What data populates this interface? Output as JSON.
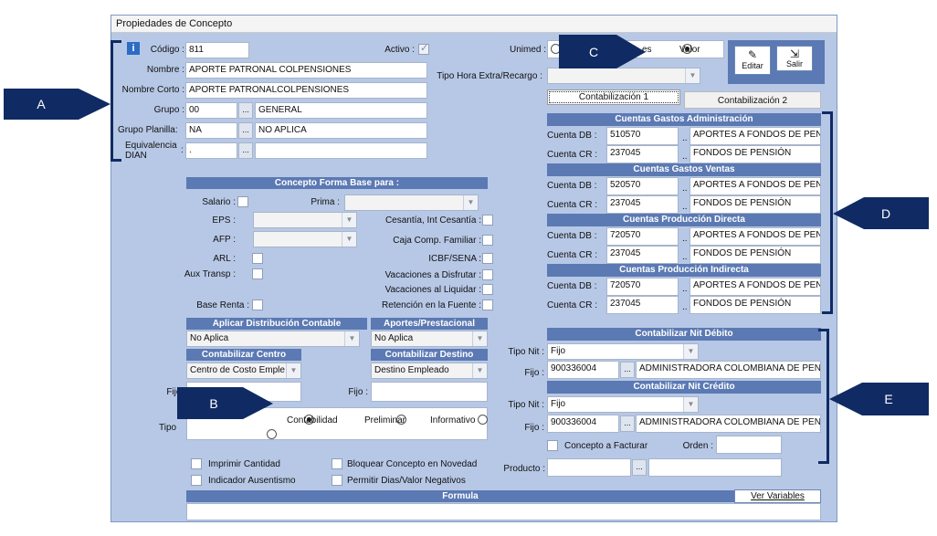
{
  "window": {
    "title": "Propiedades de Concepto"
  },
  "header": {
    "codigo_label": "Código :",
    "codigo_value": "811",
    "activo_label": "Activo :",
    "nombre_label": "Nombre :",
    "nombre_value": "APORTE PATRONAL COLPENSIONES",
    "nombre_corto_label": "Nombre Corto :",
    "nombre_corto_value": "APORTE PATRONALCOLPENSIONES",
    "grupo_label": "Grupo :",
    "grupo_code": "00",
    "grupo_name": "GENERAL",
    "grupo_planilla_label": "Grupo Planilla:",
    "grupo_planilla_code": "NA",
    "grupo_planilla_name": "NO APLICA",
    "equivalencia_label_1": "Equivalencia",
    "equivalencia_label_2": "DIAN",
    "equivalencia_value": ".",
    "dots": "...",
    "dots2": ".."
  },
  "unimed": {
    "label": "Unimed :",
    "opt1_suffix": "es",
    "opt2": "Valor",
    "tipo_hora_label": "Tipo Hora Extra/Recargo :"
  },
  "toolbar": {
    "editar": "Editar",
    "salir": "Salir"
  },
  "forma_base": {
    "title": "Concepto Forma Base para :",
    "salario": "Salario :",
    "prima": "Prima :",
    "eps": "EPS :",
    "cesantia": "Cesantía, Int Cesantía :",
    "afp": "AFP :",
    "caja": "Caja Comp. Familiar :",
    "arl": "ARL :",
    "icbf": "ICBF/SENA :",
    "aux": "Aux Transp :",
    "vac_disf": "Vacaciones a Disfrutar :",
    "vac_liq": "Vacaciones al Liquidar :",
    "base_renta": "Base Renta :",
    "retencion": "Retención en la Fuente :"
  },
  "distribucion": {
    "title": "Aplicar Distribución Contable",
    "value": "No Aplica"
  },
  "aportes": {
    "title": "Aportes/Prestacional",
    "value": "No Aplica"
  },
  "centro": {
    "title": "Contabilizar Centro",
    "value": "Centro de Costo Emple",
    "fijo": "Fijo :"
  },
  "destino": {
    "title": "Contabilizar Destino",
    "value": "Destino Empleado",
    "fijo": "Fijo :"
  },
  "tipo": {
    "label": "Tipo",
    "opt1": "Contabilidad",
    "opt2": "Preliminar",
    "opt3": "Informativo"
  },
  "checks": {
    "imprimir": "Imprimir Cantidad",
    "bloquear": "Bloquear Concepto en Novedad",
    "ausentismo": "Indicador Ausentismo",
    "permitir": "Permitir Dias/Valor Negativos"
  },
  "formula": {
    "title": "Formula",
    "ver": "Ver Variables"
  },
  "tabs": [
    "Contabilización 1",
    "Contabilización 2"
  ],
  "cuentas": [
    {
      "title": "Cuentas Gastos Administración",
      "db_label": "Cuenta DB :",
      "db_code": "510570",
      "db_name": "APORTES A FONDOS DE PEN",
      "cr_label": "Cuenta CR :",
      "cr_code": "237045",
      "cr_name": "FONDOS DE PENSIÓN"
    },
    {
      "title": "Cuentas Gastos Ventas",
      "db_label": "Cuenta DB :",
      "db_code": "520570",
      "db_name": "APORTES A FONDOS DE PEN",
      "cr_label": "Cuenta CR :",
      "cr_code": "237045",
      "cr_name": "FONDOS DE PENSIÓN"
    },
    {
      "title": "Cuentas Producción Directa",
      "db_label": "Cuenta DB :",
      "db_code": "720570",
      "db_name": "APORTES A FONDOS DE PEN",
      "cr_label": "Cuenta CR :",
      "cr_code": "237045",
      "cr_name": "FONDOS DE PENSIÓN"
    },
    {
      "title": "Cuentas Producción Indirecta",
      "db_label": "Cuenta DB :",
      "db_code": "720570",
      "db_name": "APORTES A FONDOS DE PEN",
      "cr_label": "Cuenta CR :",
      "cr_code": "237045",
      "cr_name": "FONDOS DE PENSIÓN"
    }
  ],
  "nit_debito": {
    "title": "Contabilizar Nit Débito",
    "tipo_label": "Tipo Nit :",
    "tipo_value": "Fijo",
    "fijo_label": "Fijo :",
    "nit": "900336004",
    "name": "ADMINISTRADORA COLOMBIANA DE PENS"
  },
  "nit_credito": {
    "title": "Contabilizar Nit Crédito",
    "tipo_label": "Tipo Nit :",
    "tipo_value": "Fijo",
    "fijo_label": "Fijo :",
    "nit": "900336004",
    "name": "ADMINISTRADORA COLOMBIANA DE PENS"
  },
  "facturar": {
    "label": "Concepto a Facturar",
    "orden": "Orden :",
    "producto": "Producto :"
  },
  "callouts": {
    "a": "A",
    "b": "B",
    "c": "C",
    "d": "D",
    "e": "E"
  },
  "colors": {
    "panel_bg": "#b7c8e6",
    "header_bg": "#5b79b3",
    "callout_bg": "#102b63"
  }
}
